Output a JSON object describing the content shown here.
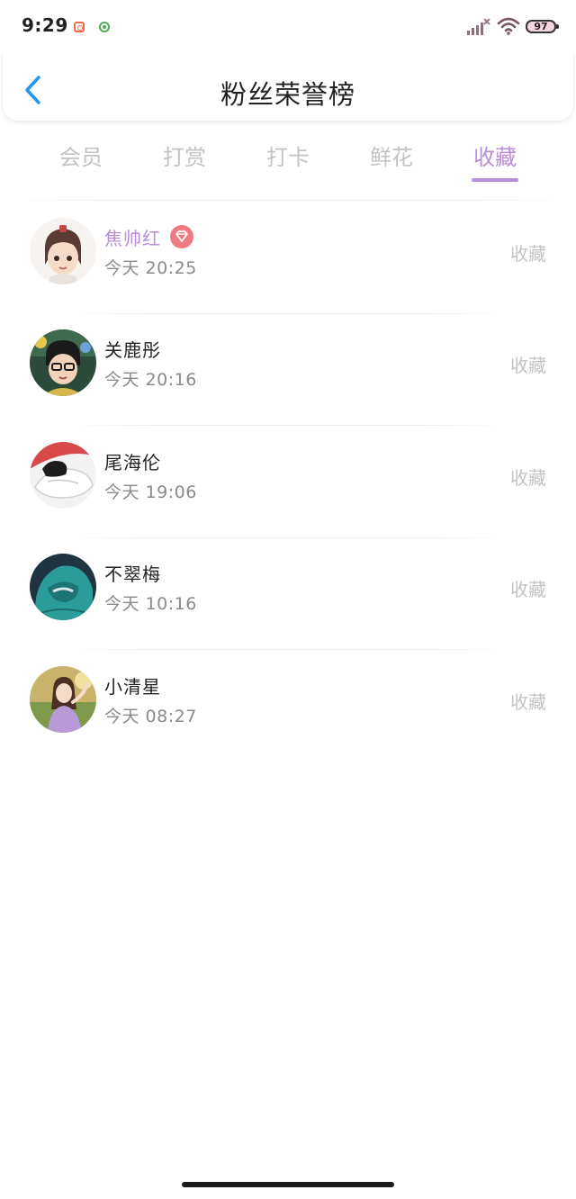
{
  "status_bar": {
    "time": "9:29",
    "battery": "97"
  },
  "header": {
    "title": "粉丝荣誉榜"
  },
  "tabs": [
    {
      "label": "会员"
    },
    {
      "label": "打赏"
    },
    {
      "label": "打卡"
    },
    {
      "label": "鲜花"
    },
    {
      "label": "收藏"
    }
  ],
  "active_tab": "收藏",
  "list": [
    {
      "name": "焦帅红",
      "time": "今天 20:25",
      "action": "收藏",
      "vip": true
    },
    {
      "name": "关鹿彤",
      "time": "今天 20:16",
      "action": "收藏"
    },
    {
      "name": "尾海伦",
      "time": "今天 19:06",
      "action": "收藏"
    },
    {
      "name": "不翠梅",
      "time": "今天 10:16",
      "action": "收藏"
    },
    {
      "name": "小清星",
      "time": "今天 08:27",
      "action": "收藏"
    }
  ],
  "colors": {
    "accent": "#b88ed6",
    "back_icon": "#2196f3",
    "inactive_tab": "#c3c3c3",
    "vip_badge": "#f17a82"
  },
  "icons": {
    "back": "chevron-left-icon",
    "vip": "diamond-icon"
  }
}
